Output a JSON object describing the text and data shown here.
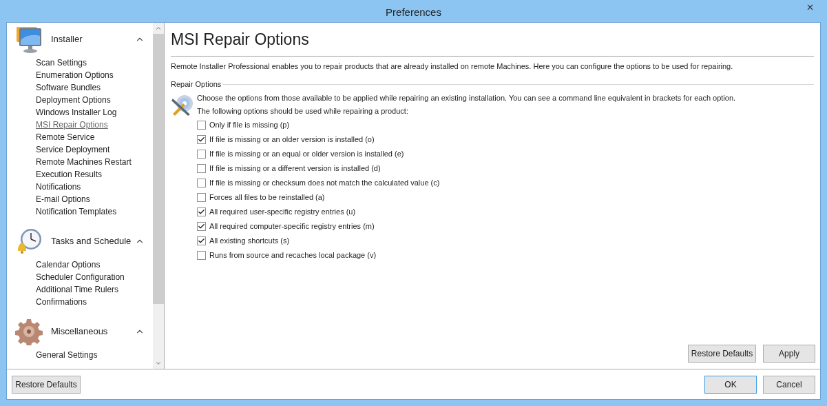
{
  "window": {
    "title": "Preferences"
  },
  "sidebar": {
    "groups": [
      {
        "title": "Installer",
        "expanded": true,
        "items": [
          {
            "label": "Scan Settings",
            "selected": false
          },
          {
            "label": "Enumeration Options",
            "selected": false
          },
          {
            "label": "Software Bundles",
            "selected": false
          },
          {
            "label": "Deployment Options",
            "selected": false
          },
          {
            "label": "Windows Installer Log",
            "selected": false
          },
          {
            "label": "MSI Repair Options",
            "selected": true
          },
          {
            "label": "Remote Service",
            "selected": false
          },
          {
            "label": "Service Deployment",
            "selected": false
          },
          {
            "label": "Remote Machines Restart",
            "selected": false
          },
          {
            "label": "Execution Results",
            "selected": false
          },
          {
            "label": "Notifications",
            "selected": false
          },
          {
            "label": "E-mail Options",
            "selected": false
          },
          {
            "label": "Notification Templates",
            "selected": false
          }
        ]
      },
      {
        "title": "Tasks and Schedule",
        "expanded": true,
        "items": [
          {
            "label": "Calendar Options",
            "selected": false
          },
          {
            "label": "Scheduler Configuration",
            "selected": false
          },
          {
            "label": "Additional Time Rulers",
            "selected": false
          },
          {
            "label": "Confirmations",
            "selected": false
          }
        ]
      },
      {
        "title": "Miscellaneous",
        "expanded": true,
        "items": [
          {
            "label": "General Settings",
            "selected": false
          }
        ]
      }
    ],
    "restore_button": "Restore Defaults"
  },
  "page": {
    "title": "MSI Repair Options",
    "description": "Remote Installer Professional enables you to repair products that are already installed on remote Machines. Here you can configure the options to be used for repairing.",
    "group_title": "Repair Options",
    "intro": "Choose the options from those available to be applied while repairing an existing installation. You can see a command line equivalent in brackets for each option.",
    "prompt": "The following options should be used while repairing a product:",
    "options": [
      {
        "label": "Only if file is missing (p)",
        "checked": false
      },
      {
        "label": "If file is missing or an older version is installed (o)",
        "checked": true
      },
      {
        "label": "If file is missing or an equal or older version is installed (e)",
        "checked": false
      },
      {
        "label": "If file is missing or a different version is installed (d)",
        "checked": false
      },
      {
        "label": "If file is missing or checksum does not match the calculated value (c)",
        "checked": false
      },
      {
        "label": "Forces all files to be reinstalled (a)",
        "checked": false
      },
      {
        "label": "All required user-specific registry entries (u)",
        "checked": true
      },
      {
        "label": "All required computer-specific registry entries (m)",
        "checked": true
      },
      {
        "label": "All existing shortcuts (s)",
        "checked": true
      },
      {
        "label": "Runs from source and recaches local package (v)",
        "checked": false
      }
    ],
    "buttons": [
      "Restore Defaults",
      "Apply"
    ]
  },
  "footer": {
    "buttons": [
      {
        "label": "OK",
        "default": true
      },
      {
        "label": "Cancel",
        "default": false
      }
    ]
  }
}
